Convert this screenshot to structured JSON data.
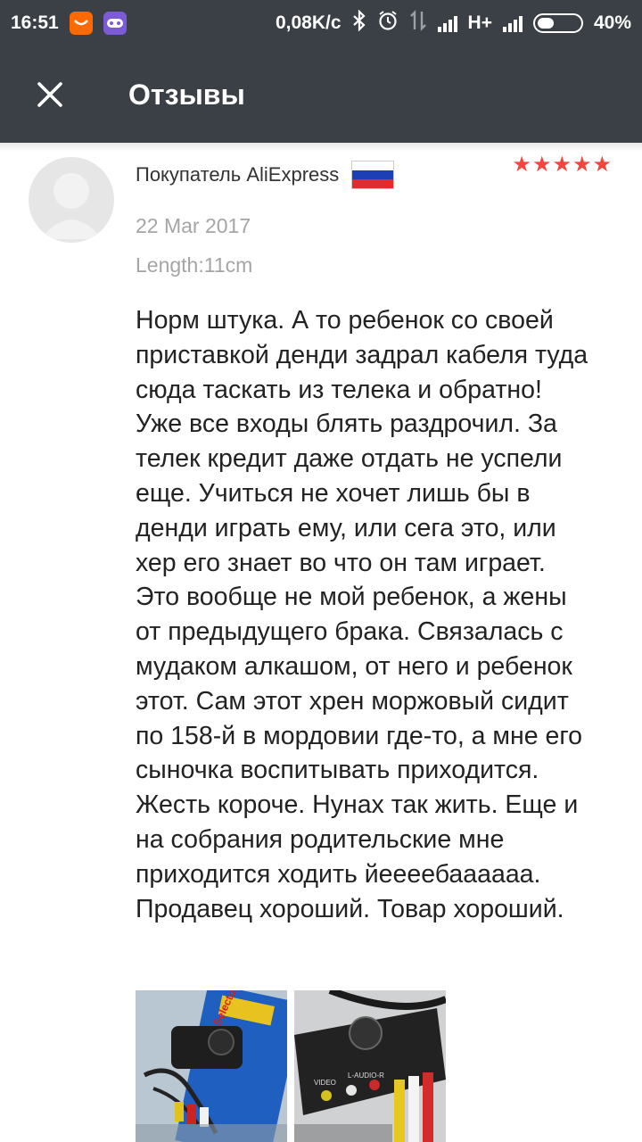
{
  "status_bar": {
    "time": "16:51",
    "notifications": [
      "aliexpress-icon",
      "gamepad-icon"
    ],
    "network_speed": "0,08K/c",
    "network_type": "H+",
    "battery": "40%",
    "battery_level": 0.4
  },
  "app_bar": {
    "title": "Отзывы",
    "close_icon": "close-icon"
  },
  "colors": {
    "app_bar": "#3a4046",
    "star": "#f2463e",
    "meta_text": "#a5a5a5",
    "body_text": "#222222"
  },
  "review": {
    "reviewer_name": "Покупатель AliExpress",
    "country_flag": "russia-flag-icon",
    "rating": 5,
    "date": "22 Mar 2017",
    "attribute": "Length:11cm",
    "text_lines": [
      "Норм штука. А то ребенок со своей",
      "приставкой денди задрал кабеля туда",
      "сюда таскать из телека и обратно!",
      "Уже все входы блять раздрочил. За",
      "телек кредит даже отдать не успели",
      "еще. Учиться не хочет лишь бы в",
      "денди играть ему, или сега это, или",
      "хер его знает во что он там играет.",
      "Это вообще не мой ребенок, а жены",
      "от предыдущего брака. Связалась с",
      "мудаком алкашом, от него и ребенок",
      "этот. Сам этот хрен моржовый сидит",
      "по 158-й в мордовии где-то, а мне его",
      "сыночка воспитывать приходится.",
      "Жесть короче. Нунах так жить. Еще и",
      "на собрания родительские мне",
      "приходится ходить йеееебаааааа.",
      "Продавец хороший. Товар хороший."
    ],
    "photos": [
      "product-photo-packaged",
      "product-photo-switch-box"
    ],
    "photo_labels": {
      "package_text": "AV Selector",
      "panel_left": "VIDEO",
      "panel_right": "L-AUDIO-R"
    }
  }
}
